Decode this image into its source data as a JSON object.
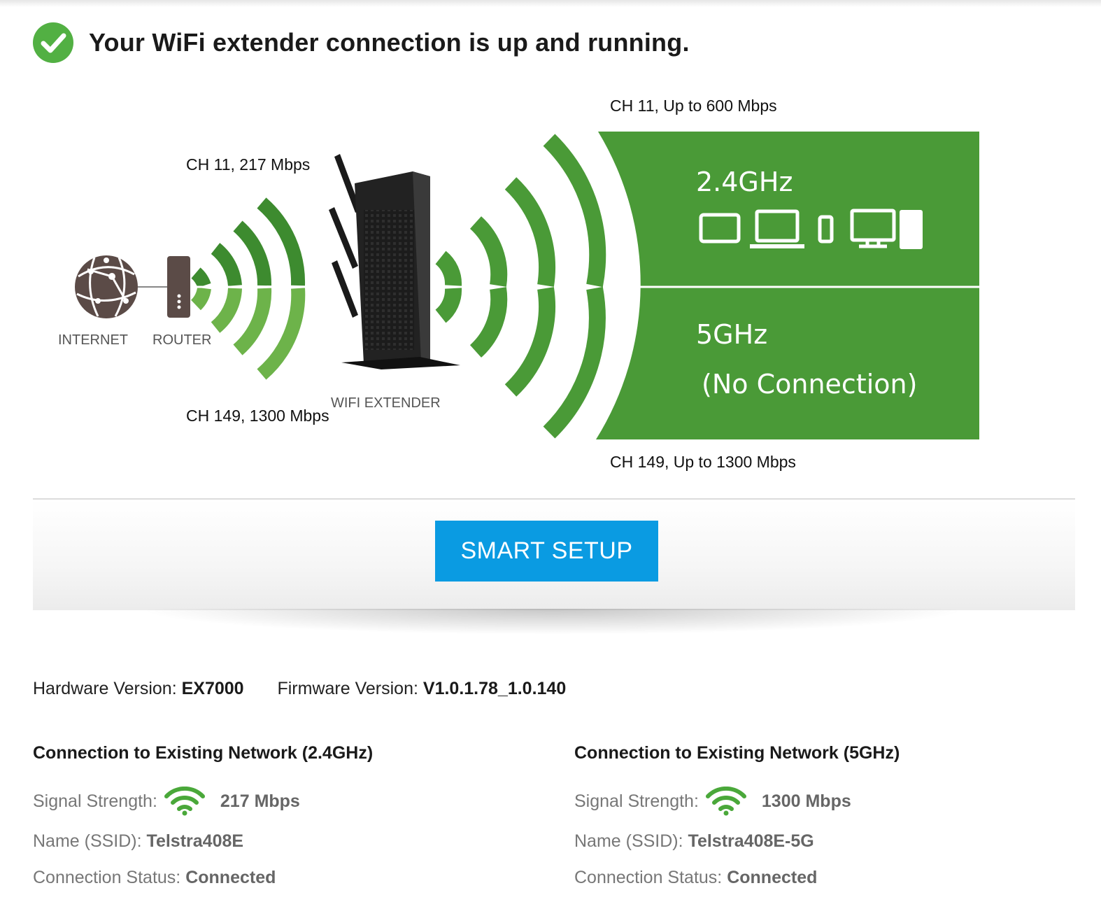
{
  "status": {
    "icon": "check-circle-icon",
    "message": "Your WiFi extender connection is up and running."
  },
  "diagram": {
    "router_link_24": "CH 11, 217 Mbps",
    "router_link_5": "CH 149, 1300 Mbps",
    "client_link_24": "CH 11, Up to 600 Mbps",
    "client_link_5": "CH 149, Up to 1300 Mbps",
    "internet_label": "INTERNET",
    "router_label": "ROUTER",
    "extender_label": "WIFI EXTENDER",
    "band_24": "2.4GHz",
    "band_5": "5GHz",
    "band_5_status": "(No Connection)",
    "colors": {
      "green": "#4a9a37",
      "light_green": "#6db34a",
      "globe": "#5b4b47"
    }
  },
  "smart_setup": {
    "label": "SMART SETUP",
    "color": "#0a9be2"
  },
  "versions": {
    "hardware_label": "Hardware Version:",
    "hardware_value": "EX7000",
    "firmware_label": "Firmware Version:",
    "firmware_value": "V1.0.1.78_1.0.140"
  },
  "networks": [
    {
      "title": "Connection to Existing Network (2.4GHz)",
      "signal_label": "Signal Strength:",
      "signal_icon": "wifi-signal-icon",
      "speed": "217 Mbps",
      "ssid_label": "Name (SSID):",
      "ssid": "Telstra408E",
      "status_label": "Connection Status:",
      "status": "Connected"
    },
    {
      "title": "Connection to Existing Network (5GHz)",
      "signal_label": "Signal Strength:",
      "signal_icon": "wifi-signal-icon",
      "speed": "1300 Mbps",
      "ssid_label": "Name (SSID):",
      "ssid": "Telstra408E-5G",
      "status_label": "Connection Status:",
      "status": "Connected"
    }
  ]
}
